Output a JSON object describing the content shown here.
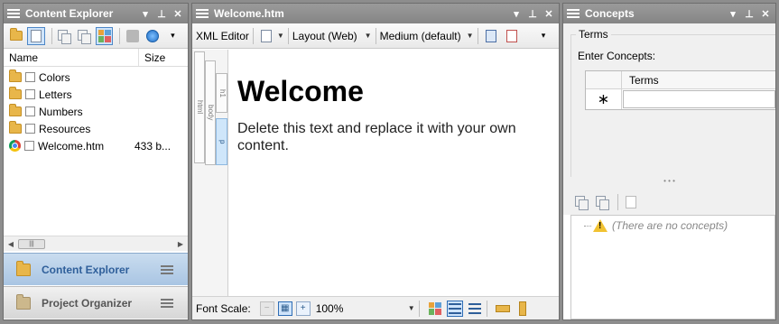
{
  "content_explorer": {
    "title": "Content Explorer",
    "columns": [
      "Name",
      "Size"
    ],
    "items": [
      {
        "name": "Colors",
        "size": "",
        "type": "folder"
      },
      {
        "name": "Letters",
        "size": "",
        "type": "folder"
      },
      {
        "name": "Numbers",
        "size": "",
        "type": "folder"
      },
      {
        "name": "Resources",
        "size": "",
        "type": "folder"
      },
      {
        "name": "Welcome.htm",
        "size": "433 b...",
        "type": "file"
      }
    ],
    "nav": {
      "content_explorer": "Content Explorer",
      "project_organizer": "Project Organizer"
    }
  },
  "editor": {
    "title": "Welcome.htm",
    "toolbar": {
      "xml_editor": "XML Editor",
      "layout": "Layout (Web)",
      "medium": "Medium (default)"
    },
    "tags": [
      "html",
      "body",
      "h1",
      "p"
    ],
    "heading": "Welcome",
    "paragraph": "Delete this text and replace it with your own content.",
    "status": {
      "font_scale_label": "Font Scale:",
      "zoom": "100%"
    }
  },
  "concepts": {
    "title": "Concepts",
    "group_label": "Terms",
    "enter_label": "Enter Concepts:",
    "column": "Terms",
    "new_row_marker": "∗",
    "empty_message": "(There are no concepts)"
  }
}
